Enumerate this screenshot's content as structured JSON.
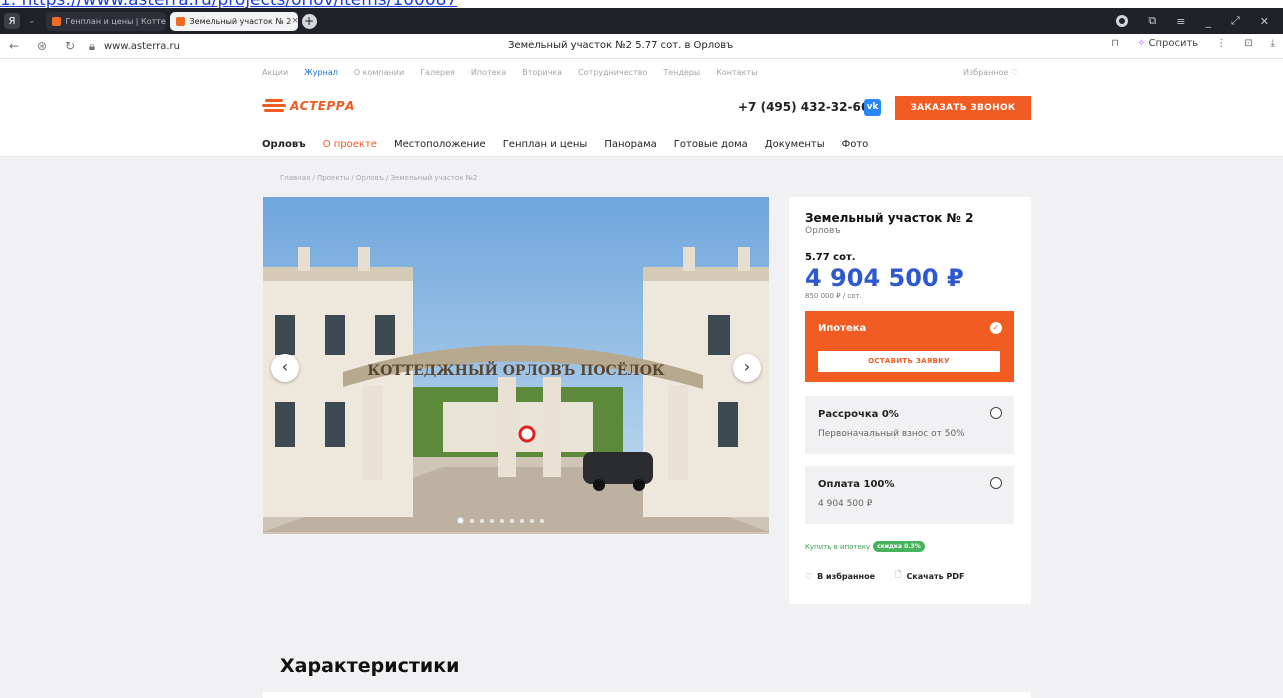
{
  "top_link": "1. https://www.asterra.ru/projects/orlov/items/100087",
  "tabs": [
    {
      "label": "Генплан и цены | Коттедж",
      "active": false
    },
    {
      "label": "Земельный участок № 2",
      "active": true
    }
  ],
  "address": {
    "url": "www.asterra.ru",
    "page_title": "Земельный участок №2 5.77 сот. в Орловъ",
    "ask": "Спросить"
  },
  "header": {
    "top_menu": [
      "Акции",
      "Журнал",
      "О компании",
      "Галерея",
      "Ипотека",
      "Вторичка",
      "Сотрудничество",
      "Тендеры",
      "Контакты"
    ],
    "favorites": "Избранное ♡",
    "logo": "АСТЕРРА",
    "phone": "+7 (495) 432-32-66",
    "vk": "vk",
    "callback_btn": "ЗАКАЗАТЬ ЗВОНОК",
    "main_menu": [
      "Орловъ",
      "О проекте",
      "Местоположение",
      "Генплан и цены",
      "Панорама",
      "Готовые дома",
      "Документы",
      "Фото"
    ]
  },
  "breadcrumb": "Главная / Проекты / Орловъ / Земельный участок №2",
  "gallery": {
    "sign": "КОТТЕДЖНЫЙ ОРЛОВЪ ПОСЁЛОК",
    "total_slides": 9,
    "active_slide": 1
  },
  "card": {
    "title": "Земельный участок № 2",
    "subtitle": "Орловъ",
    "area": "5.77 сот.",
    "price": "4 904 500 ₽",
    "price_per_unit": "850 000 ₽ / сот.",
    "options": {
      "mortgage": {
        "title": "Ипотека",
        "button": "ОСТАВИТЬ ЗАЯВКУ"
      },
      "installment": {
        "title": "Рассрочка 0%",
        "sub": "Первоначальный взнос от 50%"
      },
      "full": {
        "title": "Оплата 100%",
        "sub": "4 904 500 ₽"
      }
    },
    "buy_mortgage": "Купить в ипотеку",
    "discount": "скидка 0.3%",
    "favorite": "В избранное",
    "pdf": "Скачать PDF"
  },
  "section_title": "Характеристики",
  "colors": {
    "accent": "#f15c22",
    "price_blue": "#2e58d0",
    "green": "#47b35f"
  }
}
